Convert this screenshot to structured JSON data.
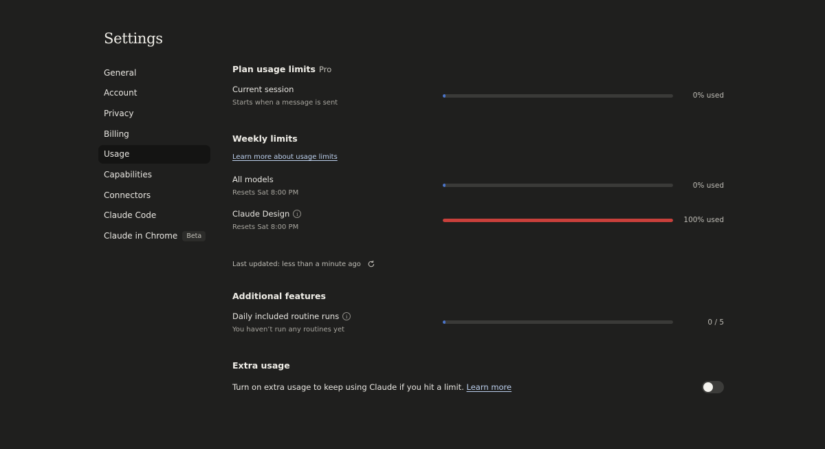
{
  "page": {
    "title": "Settings"
  },
  "sidebar": {
    "items": [
      {
        "label": "General"
      },
      {
        "label": "Account"
      },
      {
        "label": "Privacy"
      },
      {
        "label": "Billing"
      },
      {
        "label": "Usage",
        "active": true
      },
      {
        "label": "Capabilities"
      },
      {
        "label": "Connectors"
      },
      {
        "label": "Claude Code"
      },
      {
        "label": "Claude in Chrome",
        "badge": "Beta"
      }
    ]
  },
  "plan": {
    "heading": "Plan usage limits",
    "tier": "Pro",
    "current_session": {
      "label": "Current session",
      "sub": "Starts when a message is sent",
      "used_fraction": 0,
      "value_text": "0% used"
    }
  },
  "weekly": {
    "heading": "Weekly limits",
    "learn_more": "Learn more about usage limits",
    "all_models": {
      "label": "All models",
      "sub": "Resets Sat 8:00 PM",
      "used_fraction": 0,
      "value_text": "0% used"
    },
    "claude_design": {
      "label": "Claude Design",
      "sub": "Resets Sat 8:00 PM",
      "used_fraction": 1,
      "value_text": "100% used"
    },
    "last_updated": "Last updated: less than a minute ago"
  },
  "additional": {
    "heading": "Additional features",
    "routine_runs": {
      "label": "Daily included routine runs",
      "sub": "You haven’t run any routines yet",
      "used_fraction": 0,
      "value_text": "0 / 5"
    }
  },
  "extra": {
    "heading": "Extra usage",
    "text": "Turn on extra usage to keep using Claude if you hit a limit.",
    "link": "Learn more",
    "toggle_on": false
  },
  "colors": {
    "bar_fill_normal": "#4a74c9",
    "bar_fill_full": "#c9403b",
    "bar_track": "#3a3a38",
    "link": "#bcd0ee"
  },
  "icons": [
    "info-icon",
    "refresh-icon"
  ]
}
